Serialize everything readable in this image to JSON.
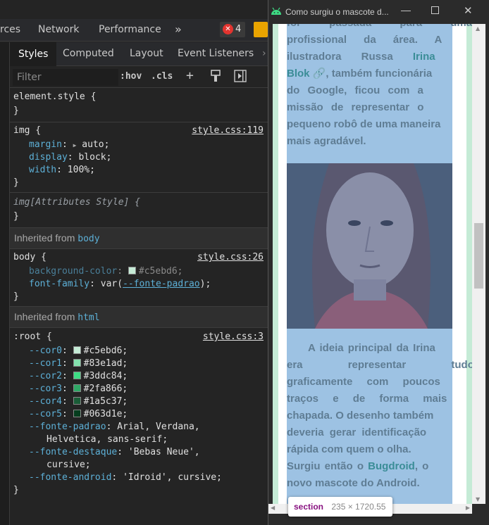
{
  "devtools": {
    "top_tabs": [
      "rces",
      "Network",
      "Performance"
    ],
    "more_tabs": "»",
    "error_count": "4",
    "sub_tabs": [
      "Styles",
      "Computed",
      "Layout",
      "Event Listeners"
    ],
    "filter": {
      "placeholder": "Filter",
      "hov": ":hov",
      "cls": ".cls",
      "plus": "+"
    },
    "element_style": {
      "selector": "element.style {",
      "close": "}"
    },
    "img_rule": {
      "selector": "img {",
      "source": "style.css:119",
      "props": [
        {
          "name": "margin",
          "value": "auto;"
        },
        {
          "name": "display",
          "value": "block;"
        },
        {
          "name": "width",
          "value": "100%;"
        }
      ],
      "close": "}"
    },
    "img_attr_rule": {
      "selector": "img[Attributes Style] {",
      "close": "}"
    },
    "inherited_body": {
      "label": "Inherited from",
      "tag": "body"
    },
    "body_rule": {
      "selector": "body {",
      "source": "style.css:26",
      "bg_name": "background-color",
      "bg_value": "#c5ebd6;",
      "font_name": "font-family",
      "font_value_pre": "var(",
      "font_value_var": "--fonte-padrao",
      "font_value_post": ");",
      "close": "}"
    },
    "inherited_html": {
      "label": "Inherited from",
      "tag": "html"
    },
    "root_rule": {
      "selector": ":root {",
      "source": "style.css:3",
      "colors": [
        {
          "name": "--cor0",
          "value": "#c5ebd6;",
          "hex": "#c5ebd6"
        },
        {
          "name": "--cor1",
          "value": "#83e1ad;",
          "hex": "#83e1ad"
        },
        {
          "name": "--cor2",
          "value": "#3ddc84;",
          "hex": "#3ddc84"
        },
        {
          "name": "--cor3",
          "value": "#2fa866;",
          "hex": "#2fa866"
        },
        {
          "name": "--cor4",
          "value": "#1a5c37;",
          "hex": "#1a5c37"
        },
        {
          "name": "--cor5",
          "value": "#063d1e;",
          "hex": "#063d1e"
        }
      ],
      "fonte_padrao_name": "--fonte-padrao",
      "fonte_padrao_l1": "Arial, Verdana,",
      "fonte_padrao_l2": "Helvetica, sans-serif;",
      "fonte_destaque_name": "--fonte-destaque",
      "fonte_destaque_l1": "'Bebas Neue',",
      "fonte_destaque_l2": "cursive;",
      "fonte_android_name": "--fonte-android",
      "fonte_android_value": "'Idroid', cursive;",
      "close": "}"
    }
  },
  "browser": {
    "title": "Como surgiu o mascote d...",
    "para1": {
      "lines": [
        "for passada para uma",
        "profissional da área. A",
        "ilustradora Russa ",
        "Blok",
        ", também funcionária",
        "do Google, ficou com a",
        "missão de representar o",
        "pequeno robô de uma maneira",
        "mais agradável."
      ],
      "highlight_1": "Irina"
    },
    "para2": {
      "lines": [
        "A ideia principal da Irina",
        "era representar tudo",
        "graficamente com poucos",
        "traços e de forma mais",
        "chapada. O desenho também",
        "deveria gerar identificação",
        "rápida com quem o olha.",
        "Surgiu então o ",
        "Bugdroid",
        ", o",
        "novo mascote do Android."
      ]
    },
    "tooltip": {
      "tag": "section",
      "size": "235 × 1720.55"
    }
  }
}
